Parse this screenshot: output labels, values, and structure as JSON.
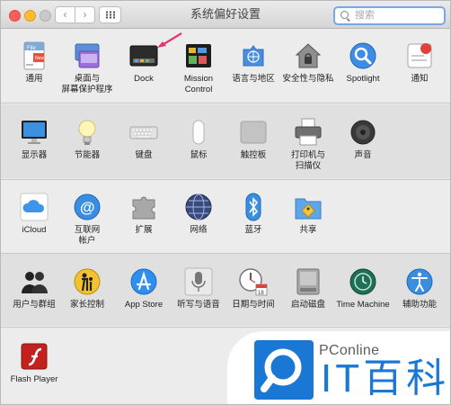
{
  "window": {
    "title": "系统偏好设置",
    "search_placeholder": "搜索",
    "nav_back": "‹",
    "nav_forward": "›"
  },
  "rows": [
    {
      "items": [
        {
          "name": "general",
          "label": "通用",
          "icon": "general-icon"
        },
        {
          "name": "desktop-screensaver",
          "label": "桌面与\n屏幕保护程序",
          "icon": "desktop-screensaver-icon"
        },
        {
          "name": "dock",
          "label": "Dock",
          "icon": "dock-icon"
        },
        {
          "name": "mission-control",
          "label": "Mission\nControl",
          "icon": "mission-control-icon"
        },
        {
          "name": "language-region",
          "label": "语言与地区",
          "icon": "language-region-icon"
        },
        {
          "name": "security-privacy",
          "label": "安全性与隐私",
          "icon": "security-privacy-icon"
        },
        {
          "name": "spotlight",
          "label": "Spotlight",
          "icon": "spotlight-icon"
        },
        {
          "name": "notifications",
          "label": "通知",
          "icon": "notifications-icon"
        }
      ]
    },
    {
      "items": [
        {
          "name": "displays",
          "label": "显示器",
          "icon": "display-icon"
        },
        {
          "name": "energy-saver",
          "label": "节能器",
          "icon": "energy-saver-icon"
        },
        {
          "name": "keyboard",
          "label": "键盘",
          "icon": "keyboard-icon"
        },
        {
          "name": "mouse",
          "label": "鼠标",
          "icon": "mouse-icon"
        },
        {
          "name": "trackpad",
          "label": "触控板",
          "icon": "trackpad-icon"
        },
        {
          "name": "printers-scanners",
          "label": "打印机与\n扫描仪",
          "icon": "printer-icon"
        },
        {
          "name": "sound",
          "label": "声音",
          "icon": "sound-icon"
        }
      ]
    },
    {
      "items": [
        {
          "name": "icloud",
          "label": "iCloud",
          "icon": "icloud-icon"
        },
        {
          "name": "internet-accounts",
          "label": "互联网\n帐户",
          "icon": "internet-accounts-icon"
        },
        {
          "name": "extensions",
          "label": "扩展",
          "icon": "extensions-icon"
        },
        {
          "name": "network",
          "label": "网络",
          "icon": "network-icon"
        },
        {
          "name": "bluetooth",
          "label": "蓝牙",
          "icon": "bluetooth-icon"
        },
        {
          "name": "sharing",
          "label": "共享",
          "icon": "sharing-icon"
        }
      ]
    },
    {
      "items": [
        {
          "name": "users-groups",
          "label": "用户与群组",
          "icon": "users-groups-icon"
        },
        {
          "name": "parental-controls",
          "label": "家长控制",
          "icon": "parental-controls-icon"
        },
        {
          "name": "app-store",
          "label": "App Store",
          "icon": "app-store-icon"
        },
        {
          "name": "dictation-speech",
          "label": "听写与语音",
          "icon": "microphone-icon"
        },
        {
          "name": "date-time",
          "label": "日期与时间",
          "icon": "clock-calendar-icon"
        },
        {
          "name": "startup-disk",
          "label": "启动磁盘",
          "icon": "startup-disk-icon"
        },
        {
          "name": "time-machine",
          "label": "Time Machine",
          "icon": "time-machine-icon"
        },
        {
          "name": "accessibility",
          "label": "辅助功能",
          "icon": "accessibility-icon"
        }
      ]
    },
    {
      "items": [
        {
          "name": "flash-player",
          "label": "Flash Player",
          "icon": "flash-player-icon"
        }
      ]
    }
  ],
  "watermark": {
    "brand": "PConline",
    "text": "IT百科"
  },
  "colors": {
    "accent": "#1a78d4",
    "annotation_arrow": "#e8336d"
  }
}
